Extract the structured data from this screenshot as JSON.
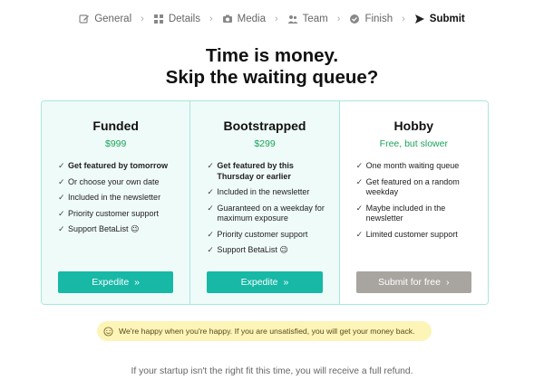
{
  "stepper": {
    "steps": [
      {
        "label": "General",
        "icon": "edit-icon"
      },
      {
        "label": "Details",
        "icon": "grid-icon"
      },
      {
        "label": "Media",
        "icon": "camera-icon"
      },
      {
        "label": "Team",
        "icon": "users-icon"
      },
      {
        "label": "Finish",
        "icon": "check-circle-icon"
      },
      {
        "label": "Submit",
        "icon": "send-icon",
        "active": true
      }
    ],
    "separator": "›"
  },
  "headline": {
    "line1": "Time is money.",
    "line2": "Skip the waiting queue?"
  },
  "plans": [
    {
      "title": "Funded",
      "price": "$999",
      "features": [
        {
          "text": "Get featured by tomorrow",
          "bold": true
        },
        {
          "text": "Or choose your own date"
        },
        {
          "text": "Included in the newsletter"
        },
        {
          "text": "Priority customer support"
        },
        {
          "text": "Support BetaList 😉"
        }
      ],
      "cta": "Expedite",
      "cta_icon": "»"
    },
    {
      "title": "Bootstrapped",
      "price": "$299",
      "features": [
        {
          "text": "Get featured by this Thursday or earlier",
          "bold": true
        },
        {
          "text": "Included in the newsletter"
        },
        {
          "text": "Guaranteed on a weekday for maximum exposure"
        },
        {
          "text": "Priority customer support"
        },
        {
          "text": "Support BetaList 😉"
        }
      ],
      "cta": "Expedite",
      "cta_icon": "»"
    },
    {
      "title": "Hobby",
      "price": "Free, but slower",
      "features": [
        {
          "text": "One month waiting queue"
        },
        {
          "text": "Get featured on a random weekday"
        },
        {
          "text": "Maybe included in the newsletter"
        },
        {
          "text": "Limited customer support"
        }
      ],
      "cta": "Submit for free",
      "cta_icon": "›"
    }
  ],
  "banner": {
    "text": "We're happy when you're happy. If you are unsatisfied, you will get your money back."
  },
  "footnote": "If your startup isn't the right fit this time, you will receive a full refund.",
  "colors": {
    "accent": "#17b8a6",
    "price": "#1aa35a",
    "banner_bg": "#fdf4b8",
    "disabled_cta": "#a8a5a1"
  }
}
